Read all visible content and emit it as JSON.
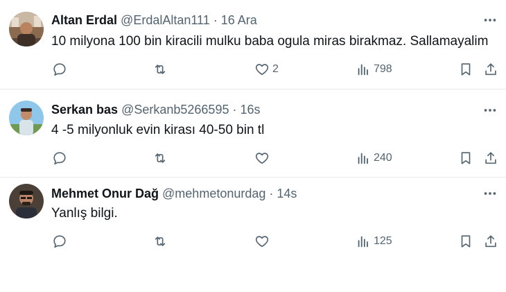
{
  "tweets": [
    {
      "name": "Altan Erdal",
      "handle": "@ErdalAltan111",
      "separator": " · ",
      "time": "16 Ara",
      "text": "10 milyona 100 bin kiracili mulku baba ogula miras birakmaz. Sallamayalim",
      "likes": "2",
      "views": "798"
    },
    {
      "name": "Serkan bas",
      "handle": "@Serkanb5266595",
      "separator": " · ",
      "time": "16s",
      "text": "4 -5 milyonluk evin kirası 40-50 bin tl",
      "likes": "",
      "views": "240"
    },
    {
      "name": "Mehmet Onur Dağ",
      "handle": "@mehmetonurdag",
      "separator": " · ",
      "time": "14s",
      "text": "Yanlış bilgi.",
      "likes": "",
      "views": "125"
    }
  ],
  "icons": {
    "reply": "reply-icon",
    "retweet": "retweet-icon",
    "like": "heart-icon",
    "views": "views-icon",
    "bookmark": "bookmark-icon",
    "share": "share-icon",
    "more": "more-icon"
  },
  "colors": {
    "text": "#0f1419",
    "secondary": "#536471",
    "divider": "#e7e9ea"
  }
}
